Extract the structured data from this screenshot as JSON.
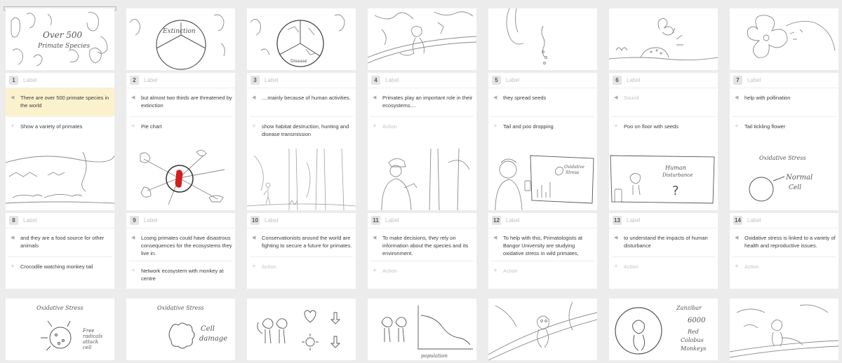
{
  "storyboard": {
    "frames": [
      {
        "number": "1",
        "label": "Label",
        "sound": "There are over 500 primate species in the world",
        "action": "Show a variety of primates",
        "thumb_text": [
          "Over 500",
          "Primate Species"
        ],
        "selected": true
      },
      {
        "number": "2",
        "label": "Label",
        "sound": "but almost two thirds are threatened by extinction",
        "action": "Pie chart",
        "thumb_text": [
          "Extinction"
        ]
      },
      {
        "number": "3",
        "label": "Label",
        "sound": "....mainly because of human activities.",
        "action": "show habitat destruction, hunting and disease transmission",
        "thumb_text": [
          "Disease"
        ]
      },
      {
        "number": "4",
        "label": "Label",
        "sound": "Primates play an important role in their ecosystems....",
        "action": "Action",
        "action_placeholder": true,
        "thumb_text": []
      },
      {
        "number": "5",
        "label": "Label",
        "sound": "they spread seeds",
        "action": "Tail and poo dropping",
        "thumb_text": []
      },
      {
        "number": "6",
        "label": "Label",
        "sound": "Sound",
        "sound_placeholder": true,
        "action": "Poo on floor with seeds",
        "thumb_text": []
      },
      {
        "number": "7",
        "label": "Label",
        "sound": "help with pollination",
        "action": "Tail tickling flower",
        "thumb_text": []
      },
      {
        "number": "8",
        "label": "Label",
        "sound": "and they are a food source for other animals",
        "action": "Crocodile watching monkey tail",
        "thumb_text": []
      },
      {
        "number": "9",
        "label": "Label",
        "sound": "Losing primates could have disastrous consequences for the ecosystems they live in.",
        "action": "Network ecosystem with monkey at centre",
        "thumb_text": []
      },
      {
        "number": "10",
        "label": "Label",
        "sound": "Conservationists around the world are fighting to secure a future for primates.",
        "action": "Action",
        "action_placeholder": true,
        "thumb_text": []
      },
      {
        "number": "11",
        "label": "Label",
        "sound": "To make decisions, they rely on information about the species and its environment.",
        "action": "Action",
        "action_placeholder": true,
        "thumb_text": []
      },
      {
        "number": "12",
        "label": "Label",
        "sound": "To help with this, Primatologists at Bangor University are studying oxidative stress in wild primates,",
        "action": "Action",
        "action_placeholder": true,
        "thumb_text": [
          "Oxidative",
          "Stress"
        ]
      },
      {
        "number": "13",
        "label": "Label",
        "sound": "to understand the impacts of human disturbance",
        "action": "Action",
        "action_placeholder": true,
        "thumb_text": [
          "Human",
          "Disturbance"
        ]
      },
      {
        "number": "14",
        "label": "Label",
        "sound": "Oxidative stress is linked to a variety of health and reproductive issues.",
        "action": "Action",
        "action_placeholder": true,
        "thumb_text": [
          "Oxidative Stress",
          "Normal",
          "Cell"
        ]
      },
      {
        "thumb_text": [
          "Oxidative Stress",
          "Free",
          "radicals",
          "attack",
          "cell"
        ]
      },
      {
        "thumb_text": [
          "Oxidative Stress",
          "Cell",
          "damage"
        ]
      },
      {
        "thumb_text": []
      },
      {
        "thumb_text": [
          "population"
        ]
      },
      {
        "thumb_text": []
      },
      {
        "thumb_text": [
          "Zanzibar",
          "6000",
          "Red",
          "Colobus",
          "Monkeys"
        ]
      },
      {
        "thumb_text": []
      }
    ]
  },
  "colors": {
    "highlight": "#fbf2cd",
    "sketch": "#8a8a8a",
    "accent_red": "#d11f1f"
  },
  "icons": {
    "sound": "speaker-icon",
    "action": "running-figure-icon"
  }
}
